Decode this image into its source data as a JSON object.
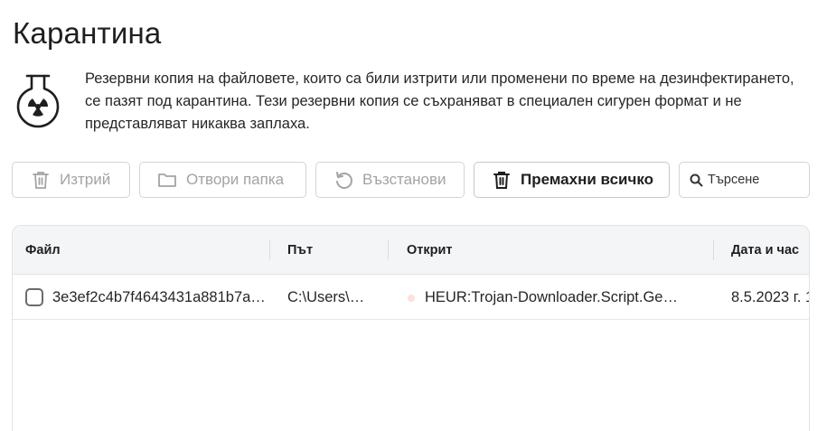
{
  "page": {
    "title": "Карантина",
    "description": "Резервни копия на файловете, които са били изтрити или променени по време на дезинфектирането, се пазят под карантина. Тези резервни копия се съхраняват в специален сигурен формат и не представляват никаква заплаха.",
    "info_icon": "radiation-flask-icon"
  },
  "toolbar": {
    "delete_label": "Изтрий",
    "open_folder_label": "Отвори папка",
    "restore_label": "Възстанови",
    "remove_all_label": "Премахни всичко",
    "search_placeholder": "Търсене"
  },
  "table": {
    "columns": [
      "Файл",
      "Път",
      "Открит",
      "Дата и час"
    ],
    "rows": [
      {
        "file": "3e3ef2c4b7f4643431a881b7a…",
        "path": "C:\\Users\\…",
        "detected": "HEUR:Trojan-Downloader.Script.Ge…",
        "datetime": "8.5.2023 г. 1",
        "severity_color": "#fde0dc"
      }
    ]
  },
  "colors": {
    "disabled_text": "#a3a3a3",
    "header_bg": "#f4f5f7",
    "border": "#d4d4d4"
  }
}
